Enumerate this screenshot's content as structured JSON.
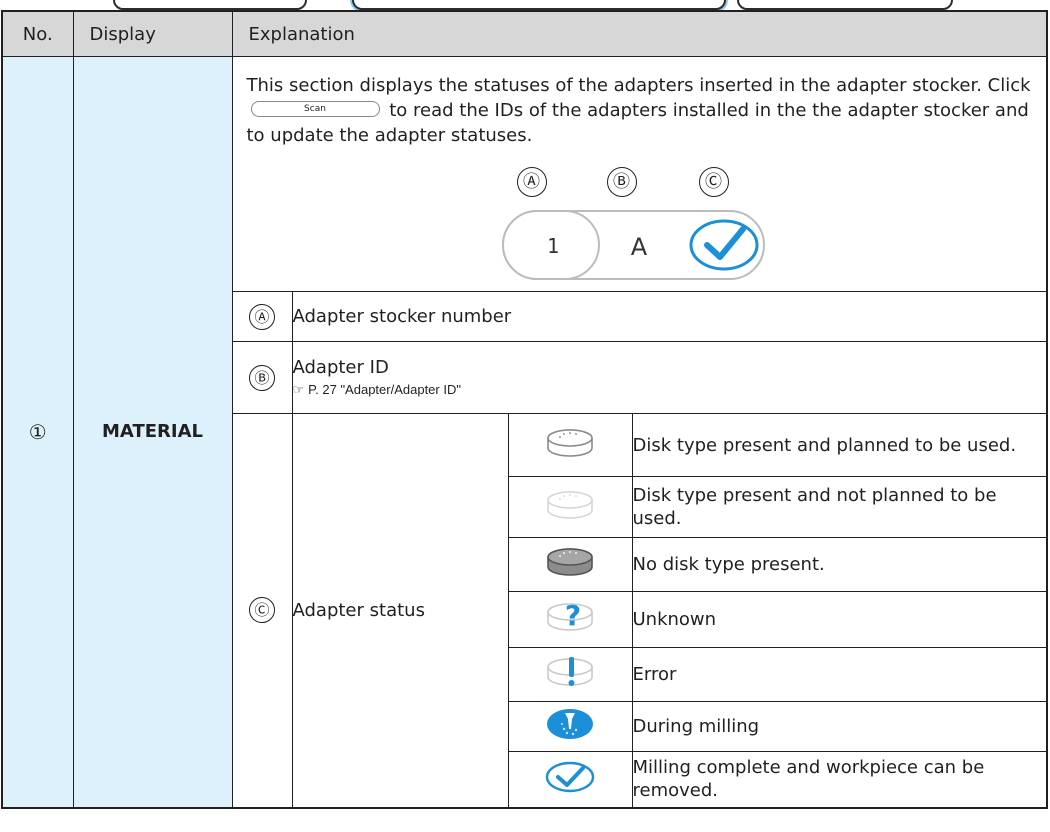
{
  "header": {
    "col_no": "No.",
    "col_display": "Display",
    "col_explanation": "Explanation"
  },
  "row": {
    "number": "①",
    "display": "MATERIAL",
    "intro_before": "This section displays the statuses of the adapters inserted in the adapter stocker. Click",
    "scan_label": "Scan",
    "intro_after": "to read the IDs of the adapters installed in the the adapter stocker and to update the adapter statuses.",
    "diagram": {
      "marker_a": "Ⓐ",
      "marker_b": "Ⓑ",
      "marker_c": "Ⓒ",
      "slot_number": "1",
      "slot_id": "A"
    }
  },
  "items": [
    {
      "marker": "Ⓐ",
      "label": "Adapter stocker number"
    },
    {
      "marker": "Ⓑ",
      "label": "Adapter ID",
      "reference": "P. 27 \"Adapter/Adapter ID\""
    },
    {
      "marker": "Ⓒ",
      "label": "Adapter status"
    }
  ],
  "statuses": [
    {
      "icon": "disk-planned-icon",
      "text": "Disk type present and planned to be used."
    },
    {
      "icon": "disk-not-planned-icon",
      "text": "Disk type present and not planned to be used."
    },
    {
      "icon": "no-disk-icon",
      "text": "No disk type present."
    },
    {
      "icon": "unknown-icon",
      "text": "Unknown"
    },
    {
      "icon": "error-icon",
      "text": "Error"
    },
    {
      "icon": "milling-icon",
      "text": "During milling"
    },
    {
      "icon": "complete-check-icon",
      "text": "Milling complete and workpiece can be removed."
    }
  ],
  "colors": {
    "header_bg": "#d7d7d7",
    "left_col_bg": "#dcf1fb",
    "accent_blue": "#1b8fd8"
  }
}
